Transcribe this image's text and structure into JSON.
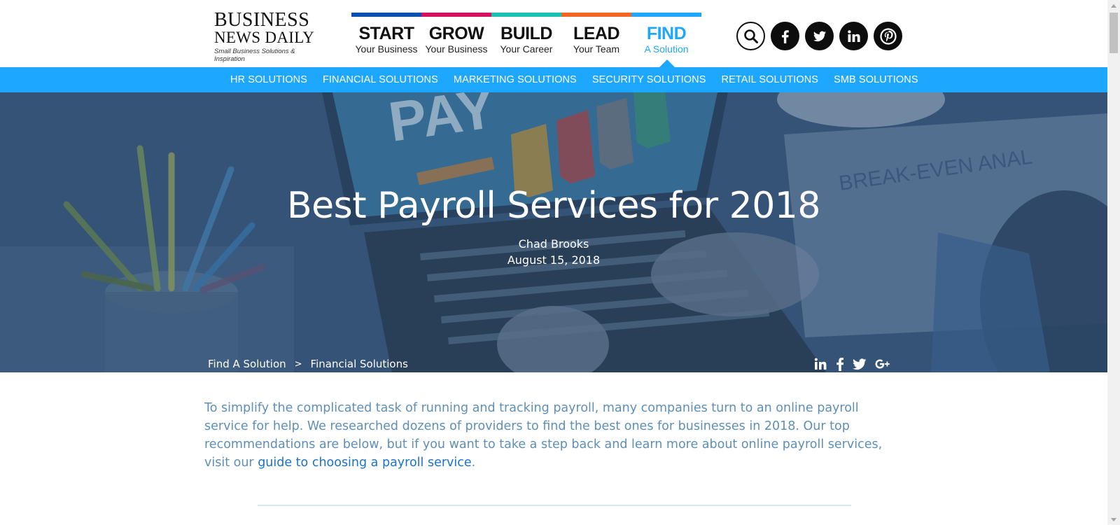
{
  "logo": {
    "line1": "BUSINESS",
    "line2": "NEWS DAILY",
    "tagline": "Small Business Solutions & Inspiration"
  },
  "nav": {
    "tabs": [
      {
        "big": "START",
        "small": "Your Business",
        "color": "#0a4fb0"
      },
      {
        "big": "GROW",
        "small": "Your Business",
        "color": "#d6105c"
      },
      {
        "big": "BUILD",
        "small": "Your Career",
        "color": "#19c3b1"
      },
      {
        "big": "LEAD",
        "small": "Your Team",
        "color": "#f26522"
      },
      {
        "big": "FIND",
        "small": "A Solution",
        "color": "#1ea7ff"
      }
    ],
    "active_tab": "FIND"
  },
  "social_icons": [
    "search-icon",
    "facebook-icon",
    "twitter-icon",
    "linkedin-icon",
    "pinterest-icon"
  ],
  "subnav": {
    "items": [
      "HR SOLUTIONS",
      "FINANCIAL SOLUTIONS",
      "MARKETING SOLUTIONS",
      "SECURITY SOLUTIONS",
      "RETAIL SOLUTIONS",
      "SMB SOLUTIONS"
    ]
  },
  "hero": {
    "title": "Best Payroll Services for 2018",
    "author": "Chad Brooks",
    "date": "August 15, 2018",
    "breadcrumb": [
      "Find A Solution",
      "Financial Solutions"
    ],
    "breadcrumb_sep": ">",
    "share_icons": [
      "linkedin-icon",
      "facebook-icon",
      "twitter-icon",
      "google-plus-icon"
    ]
  },
  "intro": {
    "text": "To simplify the complicated task of running and tracking payroll, many companies turn to an online payroll service for help. We researched dozens of providers to find the best ones for businesses in 2018. Our top recommendations are below, but if you want to take a step back and learn more about online payroll services, visit our ",
    "link_text": "guide to choosing a payroll service",
    "suffix": "."
  },
  "colors": {
    "accent": "#1ea7ff",
    "intro_text": "#5d8fb8",
    "link": "#1a73c8"
  }
}
